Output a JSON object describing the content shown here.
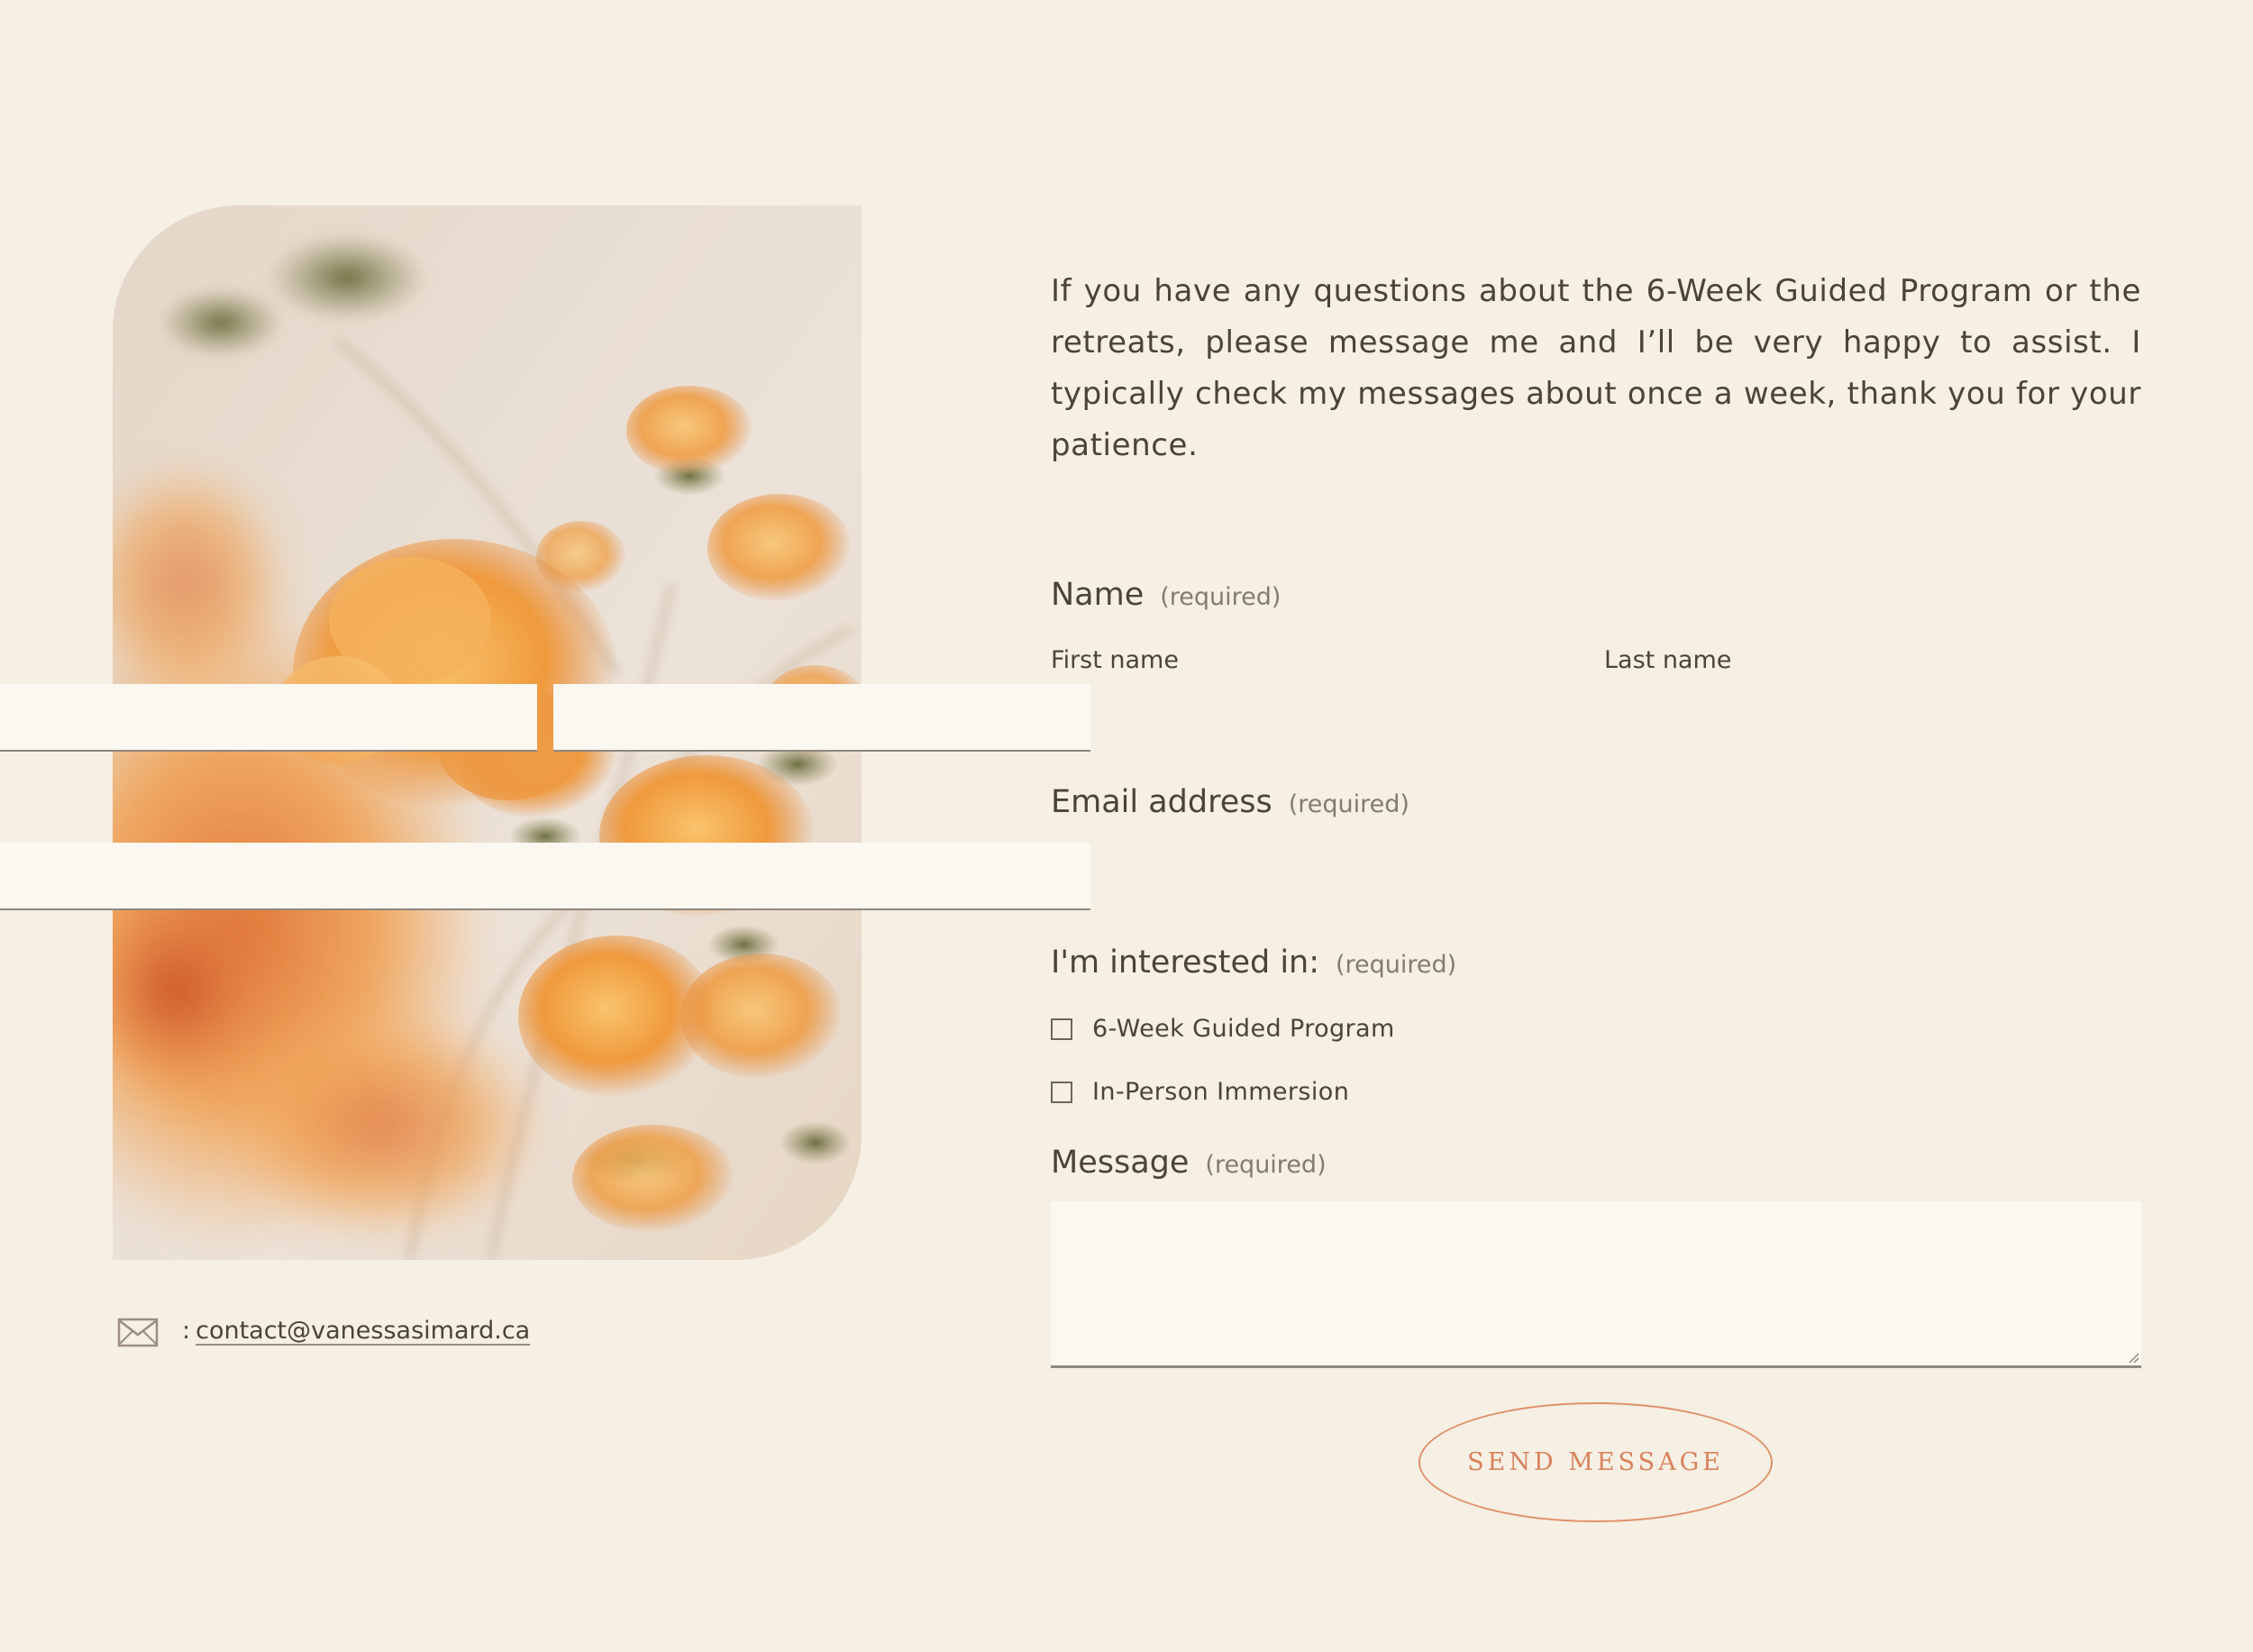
{
  "intro": {
    "text": "If you have any questions about the 6-Week Guided Program or the retreats, please message me and I’ll be very happy to assist. I typically check my messages about once a week, thank you for your patience."
  },
  "contact": {
    "icon": "envelope-icon",
    "prefix": ":",
    "email": "contact@vanessasimard.ca"
  },
  "form": {
    "name": {
      "label": "Name",
      "required": "(required)",
      "first_label": "First name",
      "first_value": "",
      "last_label": "Last name",
      "last_value": ""
    },
    "email": {
      "label": "Email address",
      "required": "(required)",
      "value": ""
    },
    "interest": {
      "label": "I'm interested in:",
      "required": "(required)",
      "options": [
        {
          "label": "6-Week Guided Program",
          "checked": false
        },
        {
          "label": "In-Person Immersion",
          "checked": false
        }
      ]
    },
    "message": {
      "label": "Message",
      "required": "(required)",
      "value": ""
    },
    "submit_label": "SEND MESSAGE"
  },
  "colors": {
    "background": "#f6efe4",
    "text": "#4e4237",
    "field_fill": "#faf8f1",
    "accent": "#df9168"
  }
}
